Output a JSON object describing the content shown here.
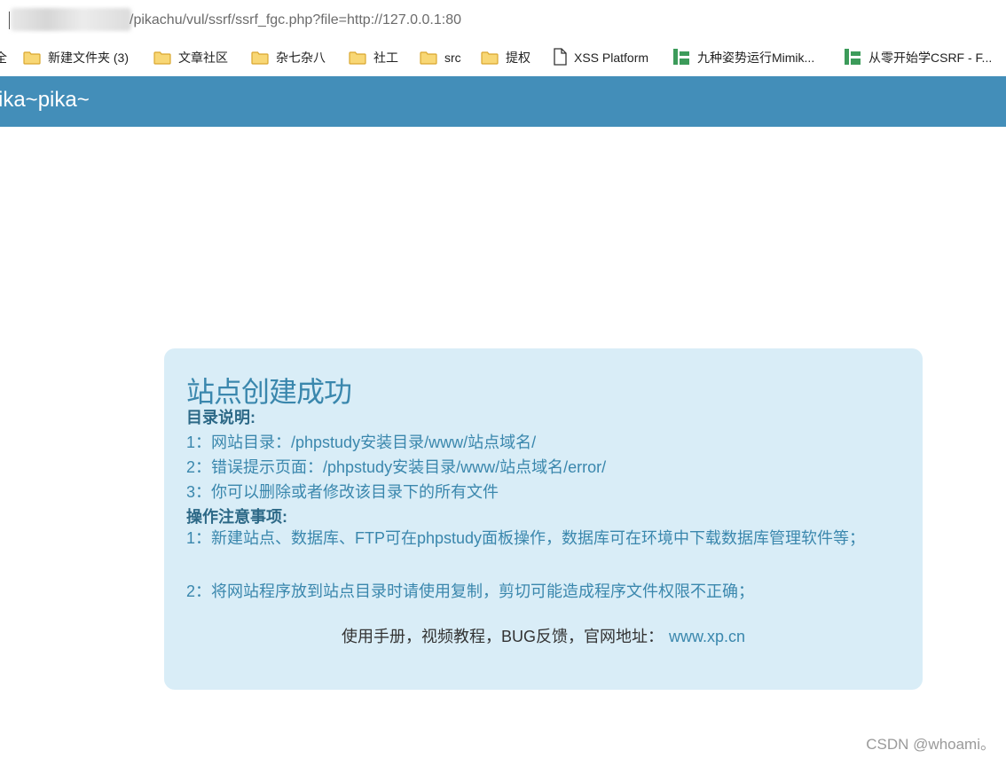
{
  "browser": {
    "address": "/pikachu/vul/ssrf/ssrf_fgc.php?file=http://127.0.0.1:80"
  },
  "bookmarks": [
    {
      "label": "全",
      "icon": "partial-label"
    },
    {
      "label": "新建文件夹 (3)",
      "icon": "folder-icon"
    },
    {
      "label": "文章社区",
      "icon": "folder-icon"
    },
    {
      "label": "杂七杂八",
      "icon": "folder-icon"
    },
    {
      "label": "社工",
      "icon": "folder-icon"
    },
    {
      "label": "src",
      "icon": "folder-icon"
    },
    {
      "label": "提权",
      "icon": "folder-icon"
    },
    {
      "label": "XSS Platform",
      "icon": "page-icon"
    },
    {
      "label": "九种姿势运行Mimik...",
      "icon": "green-site-icon"
    },
    {
      "label": "从零开始学CSRF - F...",
      "icon": "green-site-icon"
    }
  ],
  "banner": {
    "title": "ika~pika~"
  },
  "card": {
    "title": "站点创建成功",
    "dir_heading": "目录说明:",
    "dir_items": [
      "1：网站目录：/phpstudy安装目录/www/站点域名/",
      "2：错误提示页面：/phpstudy安装目录/www/站点域名/error/",
      "3：你可以删除或者修改该目录下的所有文件"
    ],
    "ops_heading": "操作注意事项:",
    "ops_items": [
      "1：新建站点、数据库、FTP可在phpstudy面板操作，数据库可在环境中下载数据库管理软件等；",
      "2：将网站程序放到站点目录时请使用复制，剪切可能造成程序文件权限不正确；"
    ],
    "footer_text": "使用手册，视频教程，BUG反馈，官网地址：",
    "footer_link": "www.xp.cn"
  },
  "watermark": "CSDN @whoami。",
  "colors": {
    "banner": "#438eb9",
    "card_bg": "#d9edf7",
    "card_text": "#3a87ad"
  }
}
